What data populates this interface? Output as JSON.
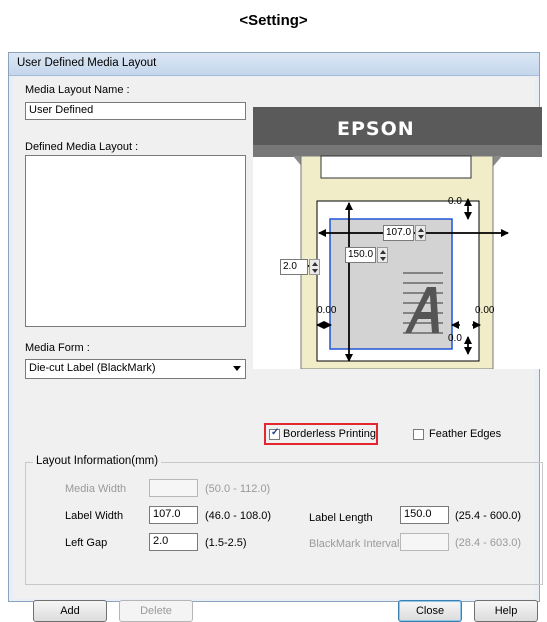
{
  "heading": "<Setting>",
  "dialog": {
    "title": "User Defined Media Layout",
    "media_layout_name_label": "Media Layout Name :",
    "media_layout_name_value": "User Defined",
    "defined_media_layout_label": "Defined Media Layout :",
    "media_form_label": "Media Form :",
    "media_form_value": "Die-cut Label (BlackMark)",
    "printer_brand": "EPSON",
    "preview": {
      "top_margin": "0.0",
      "label_width": "107.0",
      "label_length": "150.0",
      "left_gap": "2.0",
      "left_margin": "0.00",
      "right_margin": "0.00",
      "bottom_margin": "0.0"
    },
    "borderless_printing": {
      "label": "Borderless Printing",
      "checked": true
    },
    "feather_edges": {
      "label": "Feather Edges",
      "checked": false
    },
    "layout_info": {
      "title": "Layout Information(mm)",
      "media_width": {
        "label": "Media Width",
        "value": "",
        "range": "(50.0 - 112.0)"
      },
      "label_width": {
        "label": "Label Width",
        "value": "107.0",
        "range": "(46.0 - 108.0)"
      },
      "left_gap": {
        "label": "Left Gap",
        "value": "2.0",
        "range": "(1.5-2.5)"
      },
      "label_length": {
        "label": "Label Length",
        "value": "150.0",
        "range": "(25.4 - 600.0)"
      },
      "blackmark_interval": {
        "label": "BlackMark Interval",
        "value": "",
        "range": "(28.4 - 603.0)"
      }
    },
    "buttons": {
      "add": "Add",
      "delete": "Delete",
      "close": "Close",
      "help": "Help"
    },
    "colors": {
      "highlight": "#e3262f",
      "label_area": "#1f55d8",
      "printer_body": "#5a5a5a",
      "paper": "#f1edc9"
    }
  }
}
